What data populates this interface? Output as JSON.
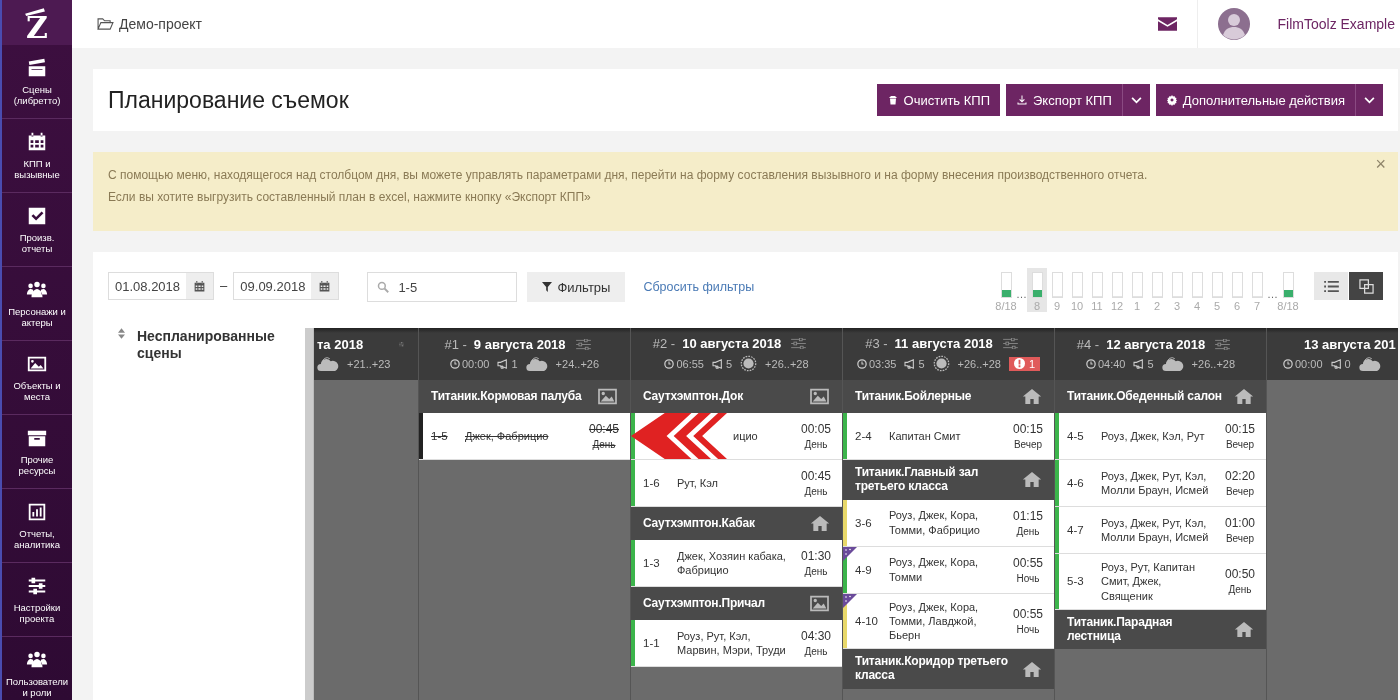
{
  "sidebar": {
    "logo": "Z",
    "items": [
      {
        "label": "Сцены (либретто)",
        "selected": false
      },
      {
        "label": "КПП и вызывные",
        "selected": false
      },
      {
        "label": "Произв. отчеты",
        "selected": false
      },
      {
        "label": "Персонажи и актеры",
        "selected": false
      },
      {
        "label": "Объекты и места",
        "selected": false
      },
      {
        "label": "Прочие ресурсы",
        "selected": false
      },
      {
        "label": "Отчеты, аналитика",
        "selected": false
      },
      {
        "label": "Настройки проекта",
        "selected": false
      },
      {
        "label": "Пользователи и роли",
        "selected": false
      }
    ]
  },
  "header": {
    "project": "Демо-проект",
    "user": "FilmToolz Example"
  },
  "page_title": "Планирование съемок",
  "actions": [
    {
      "label": "Очистить КПП",
      "kind": "plain"
    },
    {
      "label": "Экспорт КПП",
      "kind": "split"
    },
    {
      "label": "Дополнительные действия",
      "kind": "split"
    }
  ],
  "alert": {
    "lines": [
      "С помощью меню, находящегося над столбцом дня, вы можете управлять параметрами дня, перейти на форму составления вызывного и на форму внесения производственного отчета.",
      "Если вы хотите выгрузить составленный план в excel, нажмите кнопку «Экспорт КПП»"
    ],
    "close": "×"
  },
  "filters": {
    "date_from": "01.08.2018",
    "separator": "–",
    "date_to": "09.09.2018",
    "search": "1-5",
    "filter_button": "Фильтры",
    "reset_link": "Сбросить фильтры"
  },
  "timeline": [
    {
      "kind": "bar",
      "label": "8/18",
      "level": 0.3,
      "selected": false
    },
    {
      "kind": "gap",
      "label": "…"
    },
    {
      "kind": "bar",
      "label": "8",
      "level": 0.3,
      "selected": true
    },
    {
      "kind": "bar",
      "label": "9",
      "level": 0,
      "selected": false
    },
    {
      "kind": "bar",
      "label": "10",
      "level": 0,
      "selected": false
    },
    {
      "kind": "bar",
      "label": "11",
      "level": 0,
      "selected": false
    },
    {
      "kind": "bar",
      "label": "12",
      "level": 0,
      "selected": false
    },
    {
      "kind": "bar",
      "label": "1",
      "level": 0,
      "selected": false
    },
    {
      "kind": "bar",
      "label": "2",
      "level": 0,
      "selected": false
    },
    {
      "kind": "bar",
      "label": "3",
      "level": 0,
      "selected": false
    },
    {
      "kind": "bar",
      "label": "4",
      "level": 0,
      "selected": false
    },
    {
      "kind": "bar",
      "label": "5",
      "level": 0,
      "selected": false
    },
    {
      "kind": "bar",
      "label": "6",
      "level": 0,
      "selected": false
    },
    {
      "kind": "bar",
      "label": "7",
      "level": 0,
      "selected": false
    },
    {
      "kind": "gap",
      "label": "…"
    },
    {
      "kind": "bar",
      "label": "8/18",
      "level": 0.3,
      "selected": false
    }
  ],
  "view_toggle": [
    {
      "kind": "list",
      "selected": false
    },
    {
      "kind": "cards",
      "selected": true
    }
  ],
  "unplanned": {
    "title": "Неспланированные сцены"
  },
  "days": [
    {
      "date": "та 2018",
      "weather": {
        "kind": "cloud"
      },
      "temp": "+21..+23"
    },
    {
      "prefix": "#1 -",
      "date": "9 августа 2018",
      "time": "00:00",
      "calls": "1",
      "weather": {
        "kind": "cloud"
      },
      "temp": "+24..+26",
      "locations": [
        {
          "name": "Титаник.Кормовая палуба",
          "kind": "natural",
          "scenes": [
            {
              "kind": "normal",
              "number": "1-5",
              "cast": "Джек, Фабрицио",
              "time": "00:45",
              "daypart": "День",
              "color": "#222222",
              "done": true,
              "flag": false
            }
          ]
        }
      ]
    },
    {
      "prefix": "#2 -",
      "date": "10 августа 2018",
      "time": "06:55",
      "calls": "5",
      "weather": {
        "kind": "sun"
      },
      "temp": "+26..+28",
      "locations": [
        {
          "name": "Саутхэмптон.Док",
          "kind": "natural",
          "scenes": [
            {
              "kind": "drop",
              "cast": "ицио",
              "time": "00:05",
              "daypart": "День",
              "color": "#3cb44b",
              "done": false,
              "flag": false
            },
            {
              "kind": "normal",
              "number": "1-6",
              "cast": "Рут, Кэл",
              "time": "00:45",
              "daypart": "День",
              "color": "#3cb44b",
              "done": false,
              "flag": false
            }
          ]
        },
        {
          "name": "Саутхэмптон.Кабак",
          "kind": "set",
          "scenes": [
            {
              "kind": "normal",
              "number": "1-3",
              "cast": "Джек, Хозяин кабака, Фабрицио",
              "time": "01:30",
              "daypart": "День",
              "color": "#3cb44b",
              "done": false,
              "flag": false
            }
          ]
        },
        {
          "name": "Саутхэмптон.Причал",
          "kind": "natural",
          "scenes": [
            {
              "kind": "normal",
              "number": "1-1",
              "cast": "Роуз, Рут, Кэл, Марвин, Мэри, Труди",
              "time": "04:30",
              "daypart": "День",
              "color": "#3cb44b",
              "done": false,
              "flag": false
            }
          ]
        }
      ]
    },
    {
      "prefix": "#3 -",
      "date": "11 августа 2018",
      "time": "03:35",
      "calls": "5",
      "weather": {
        "kind": "sun"
      },
      "temp": "+26..+28",
      "alert": "1",
      "locations": [
        {
          "name": "Титаник.Бойлерные",
          "kind": "set",
          "scenes": [
            {
              "kind": "normal",
              "number": "2-4",
              "cast": "Капитан Смит",
              "time": "00:15",
              "daypart": "Вечер",
              "color": "#3cb44b",
              "done": false,
              "flag": false
            }
          ]
        },
        {
          "name": "Титаник.Главный зал третьего класса",
          "kind": "set",
          "scenes": [
            {
              "kind": "normal",
              "number": "3-6",
              "cast": "Роуз, Джек, Кора, Томми, Фабрицио",
              "time": "01:15",
              "daypart": "День",
              "color": "#e8d86a",
              "done": false,
              "flag": false
            },
            {
              "kind": "normal",
              "number": "4-9",
              "cast": "Роуз, Джек, Кора, Томми",
              "time": "00:55",
              "daypart": "Ночь",
              "color": "#3cb44b",
              "done": false,
              "flag": true
            },
            {
              "kind": "normal",
              "number": "4-10",
              "cast": "Роуз, Джек, Кора, Томми, Лавджой, Бьерн",
              "time": "00:55",
              "daypart": "Ночь",
              "color": "#e8d86a",
              "done": false,
              "flag": true
            }
          ]
        },
        {
          "name": "Титаник.Коридор третьего класса",
          "kind": "set"
        }
      ]
    },
    {
      "prefix": "#4 -",
      "date": "12 августа 2018",
      "time": "04:40",
      "calls": "5",
      "weather": {
        "kind": "cloud"
      },
      "temp": "+26..+28",
      "locations": [
        {
          "name": "Титаник.Обеденный салон",
          "kind": "set",
          "scenes": [
            {
              "kind": "normal",
              "number": "4-5",
              "cast": "Роуз, Джек, Кэл, Рут",
              "time": "00:15",
              "daypart": "Вечер",
              "color": "#3cb44b",
              "done": false,
              "flag": false
            },
            {
              "kind": "normal",
              "number": "4-6",
              "cast": "Роуз, Джек, Рут, Кэл, Молли Браун, Исмей",
              "time": "02:20",
              "daypart": "Вечер",
              "color": "#3cb44b",
              "done": false,
              "flag": false
            },
            {
              "kind": "normal",
              "number": "4-7",
              "cast": "Роуз, Джек, Рут, Кэл, Молли Браун, Исмей",
              "time": "01:00",
              "daypart": "Вечер",
              "color": "#3cb44b",
              "done": false,
              "flag": false
            },
            {
              "kind": "normal",
              "number": "5-3",
              "cast": "Роуз, Рут, Капитан Смит, Джек, Священик",
              "time": "00:50",
              "daypart": "День",
              "color": "#3cb44b",
              "done": false,
              "flag": false
            }
          ]
        },
        {
          "name": "Титаник.Парадная лестница",
          "kind": "set"
        }
      ]
    },
    {
      "date": "13 августа 201",
      "time": "00:00",
      "calls": "0",
      "weather": {
        "kind": "cloud"
      }
    }
  ]
}
